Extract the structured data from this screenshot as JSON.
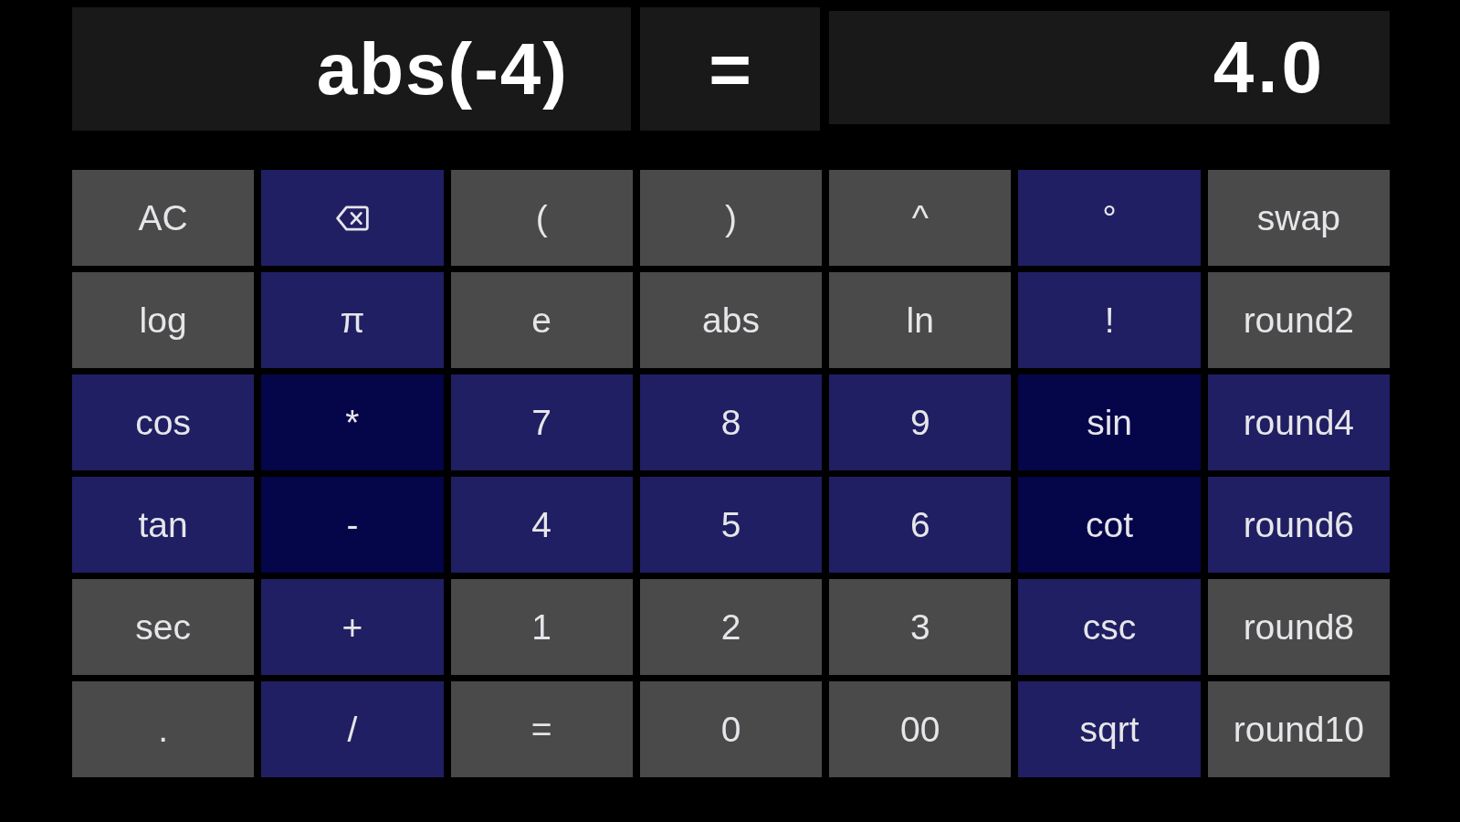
{
  "display": {
    "expression": "abs(-4)",
    "equals": "=",
    "result": "4.0"
  },
  "keys": [
    [
      {
        "kind": "text",
        "label": "AC",
        "color": "#4a4a4a"
      },
      {
        "kind": "icon",
        "color": "#201f63"
      },
      {
        "kind": "text",
        "label": "(",
        "color": "#4a4a4a"
      },
      {
        "kind": "text",
        "label": ")",
        "color": "#4a4a4a"
      },
      {
        "kind": "text",
        "label": "^",
        "color": "#4a4a4a"
      },
      {
        "kind": "text",
        "label": "°",
        "color": "#201f63"
      },
      {
        "kind": "text",
        "label": "swap",
        "color": "#4a4a4a"
      }
    ],
    [
      {
        "kind": "text",
        "label": "log",
        "color": "#4a4a4a"
      },
      {
        "kind": "text",
        "label": "π",
        "color": "#201f63"
      },
      {
        "kind": "text",
        "label": "e",
        "color": "#4a4a4a"
      },
      {
        "kind": "text",
        "label": "abs",
        "color": "#4a4a4a"
      },
      {
        "kind": "text",
        "label": "ln",
        "color": "#4a4a4a"
      },
      {
        "kind": "text",
        "label": "!",
        "color": "#201f63"
      },
      {
        "kind": "text",
        "label": "round2",
        "color": "#4a4a4a"
      }
    ],
    [
      {
        "kind": "text",
        "label": "cos",
        "color": "#201f63"
      },
      {
        "kind": "text",
        "label": "*",
        "color": "#05054a"
      },
      {
        "kind": "text",
        "label": "7",
        "color": "#201f63"
      },
      {
        "kind": "text",
        "label": "8",
        "color": "#201f63"
      },
      {
        "kind": "text",
        "label": "9",
        "color": "#201f63"
      },
      {
        "kind": "text",
        "label": "sin",
        "color": "#05054a"
      },
      {
        "kind": "text",
        "label": "round4",
        "color": "#201f63"
      }
    ],
    [
      {
        "kind": "text",
        "label": "tan",
        "color": "#201f63"
      },
      {
        "kind": "text",
        "label": "-",
        "color": "#05054a"
      },
      {
        "kind": "text",
        "label": "4",
        "color": "#201f63"
      },
      {
        "kind": "text",
        "label": "5",
        "color": "#201f63"
      },
      {
        "kind": "text",
        "label": "6",
        "color": "#201f63"
      },
      {
        "kind": "text",
        "label": "cot",
        "color": "#05054a"
      },
      {
        "kind": "text",
        "label": "round6",
        "color": "#201f63"
      }
    ],
    [
      {
        "kind": "text",
        "label": "sec",
        "color": "#4a4a4a"
      },
      {
        "kind": "text",
        "label": "+",
        "color": "#201f63"
      },
      {
        "kind": "text",
        "label": "1",
        "color": "#4a4a4a"
      },
      {
        "kind": "text",
        "label": "2",
        "color": "#4a4a4a"
      },
      {
        "kind": "text",
        "label": "3",
        "color": "#4a4a4a"
      },
      {
        "kind": "text",
        "label": "csc",
        "color": "#201f63"
      },
      {
        "kind": "text",
        "label": "round8",
        "color": "#4a4a4a"
      }
    ],
    [
      {
        "kind": "text",
        "label": ".",
        "color": "#4a4a4a"
      },
      {
        "kind": "text",
        "label": "/",
        "color": "#201f63"
      },
      {
        "kind": "text",
        "label": "=",
        "color": "#4a4a4a"
      },
      {
        "kind": "text",
        "label": "0",
        "color": "#4a4a4a"
      },
      {
        "kind": "text",
        "label": "00",
        "color": "#4a4a4a"
      },
      {
        "kind": "text",
        "label": "sqrt",
        "color": "#201f63"
      },
      {
        "kind": "text",
        "label": "round10",
        "color": "#4a4a4a"
      }
    ]
  ]
}
